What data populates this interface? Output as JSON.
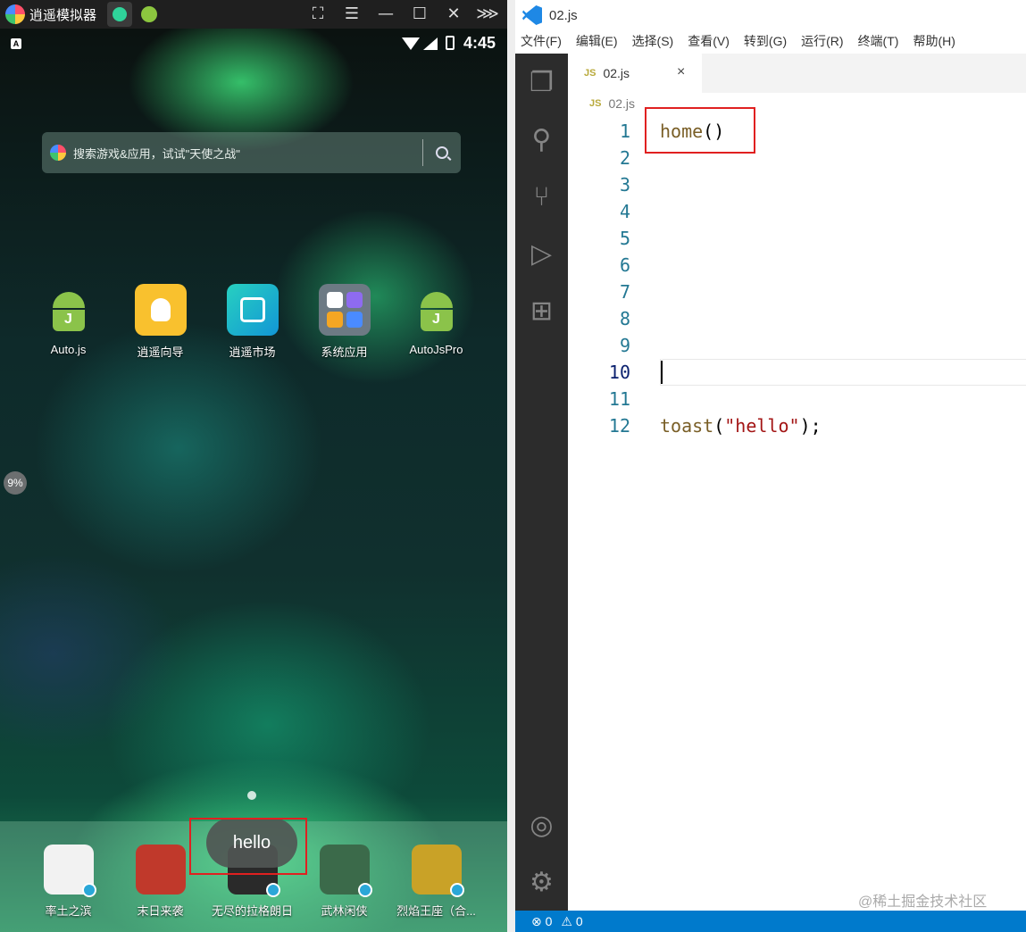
{
  "emulator": {
    "title": "逍遥模拟器",
    "controls": [
      "⛶",
      "☰",
      "—",
      "☐",
      "✕",
      "⋙"
    ],
    "status": {
      "time": "4:45",
      "indicator": "A"
    },
    "search_placeholder": "搜索游戏&应用，试试\"天使之战\"",
    "apps": [
      {
        "label": "Auto.js"
      },
      {
        "label": "逍遥向导"
      },
      {
        "label": "逍遥市场"
      },
      {
        "label": "系统应用"
      },
      {
        "label": "AutoJsPro"
      }
    ],
    "droid_letter": "J",
    "progress_bubble": "9%",
    "dock": [
      {
        "label": "率土之滨",
        "color": "#f2f2f2"
      },
      {
        "label": "末日来袭",
        "color": "#c0392b"
      },
      {
        "label": "无尽的拉格朗日",
        "color": "#2a2a2a"
      },
      {
        "label": "武林闲侠",
        "color": "#3b6a4a"
      },
      {
        "label": "烈焰王座（合...",
        "color": "#c9a227"
      }
    ],
    "toast_text": "hello"
  },
  "vscode": {
    "window_title": "02.js",
    "menu": [
      "文件(F)",
      "编辑(E)",
      "选择(S)",
      "查看(V)",
      "转到(G)",
      "运行(R)",
      "终端(T)",
      "帮助(H)"
    ],
    "tab": {
      "badge": "JS",
      "name": "02.js",
      "close": "×"
    },
    "breadcrumb": "02.js",
    "line_numbers": [
      "1",
      "2",
      "3",
      "4",
      "5",
      "6",
      "7",
      "8",
      "9",
      "10",
      "11",
      "12"
    ],
    "code": {
      "line1_fn": "home",
      "line1_paren": "()",
      "line12_fn": "toast",
      "line12_open": "(",
      "line12_str": "\"hello\"",
      "line12_close": ");"
    },
    "status": {
      "errors": "⊗ 0",
      "warnings": "⚠ 0"
    },
    "watermark": "@稀土掘金技术社区"
  }
}
